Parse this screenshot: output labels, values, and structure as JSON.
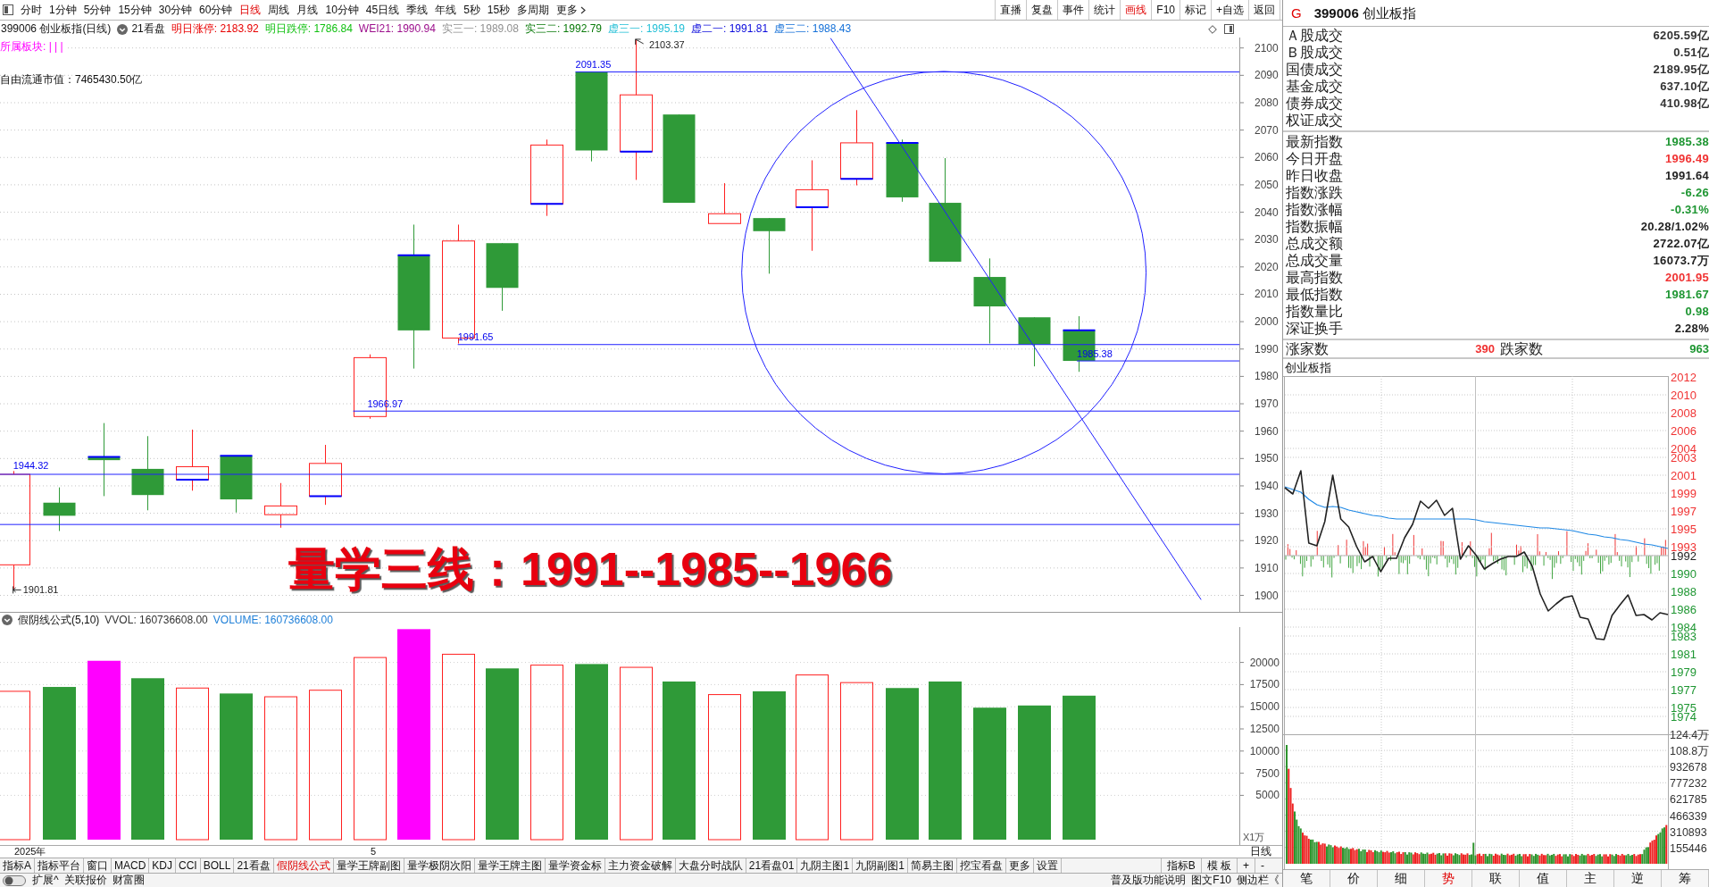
{
  "toolbar": {
    "periods": [
      {
        "label": "分时",
        "selected": false
      },
      {
        "label": "1分钟",
        "selected": false
      },
      {
        "label": "5分钟",
        "selected": false
      },
      {
        "label": "15分钟",
        "selected": false
      },
      {
        "label": "30分钟",
        "selected": false
      },
      {
        "label": "60分钟",
        "selected": false
      },
      {
        "label": "日线",
        "selected": true
      },
      {
        "label": "周线",
        "selected": false
      },
      {
        "label": "月线",
        "selected": false
      },
      {
        "label": "10分钟",
        "selected": false
      },
      {
        "label": "45日线",
        "selected": false
      },
      {
        "label": "季线",
        "selected": false
      },
      {
        "label": "年线",
        "selected": false
      },
      {
        "label": "5秒",
        "selected": false
      },
      {
        "label": "15秒",
        "selected": false
      },
      {
        "label": "多周期",
        "selected": false
      }
    ],
    "more": "更多",
    "tools": [
      {
        "label": "直播",
        "selected": false
      },
      {
        "label": "复盘",
        "selected": false
      },
      {
        "label": "事件",
        "selected": false
      },
      {
        "label": "统计",
        "selected": false
      },
      {
        "label": "画线",
        "selected": true
      },
      {
        "label": "F10",
        "selected": false
      },
      {
        "label": "标记",
        "selected": false
      },
      {
        "label": "+自选",
        "selected": false
      },
      {
        "label": "返回",
        "selected": false
      }
    ]
  },
  "info_line": {
    "title": "399006 创业板指(日线)",
    "template": "21看盘",
    "values": [
      {
        "label": "明日涨停: 2183.92",
        "color": "#e80000"
      },
      {
        "label": "明日跌停: 1786.84",
        "color": "#10c010"
      },
      {
        "label": "WEI21: 1990.94",
        "color": "#9c0f8c"
      },
      {
        "label": "实三一: 1989.08",
        "color": "#909090"
      },
      {
        "label": "实三二: 1992.79",
        "color": "#0a7a0a"
      },
      {
        "label": "虚三一: 1995.19",
        "color": "#22bfd6"
      },
      {
        "label": "虚二一: 1991.81",
        "color": "#0a0adc"
      },
      {
        "label": "虚三二: 1988.43",
        "color": "#1470d8"
      }
    ]
  },
  "main_chart": {
    "sector": "所属板块: | | |",
    "float_cap": "自由流通市值：7465430.50亿",
    "price_ticks": [
      "2100",
      "2090",
      "2080",
      "2070",
      "2060",
      "2050",
      "2040",
      "2030",
      "2020",
      "2010",
      "2000",
      "1990",
      "1980",
      "1970",
      "1960",
      "1950",
      "1940",
      "1930",
      "1920",
      "1910",
      "1900"
    ],
    "labels": [
      {
        "text": "2091.35",
        "kind": "level"
      },
      {
        "text": "2103.37",
        "kind": "high"
      },
      {
        "text": "1991.65",
        "kind": "level"
      },
      {
        "text": "1985.38",
        "kind": "level"
      },
      {
        "text": "1966.97",
        "kind": "level"
      },
      {
        "text": "1944.32",
        "kind": "level"
      },
      {
        "text": "1901.81",
        "kind": "low"
      }
    ],
    "headline": "量学三线：1991--1985--1966"
  },
  "volume_pane": {
    "title": "假阴线公式(5,10)",
    "readings": [
      {
        "label": "VVOL: 160736608.00",
        "color": "#333333"
      },
      {
        "label": "VOLUME: 160736608.00",
        "color": "#1e7fd8"
      }
    ],
    "ticks": [
      "20000",
      "17500",
      "15000",
      "12500",
      "10000",
      "7500",
      "5000"
    ],
    "unit": "X1万"
  },
  "date_axis": {
    "labels": [
      "2025年",
      "5"
    ],
    "period": "日线"
  },
  "indicator_bar": {
    "tabs": [
      {
        "label": "指标A",
        "selected": false
      },
      {
        "label": "指标平台",
        "selected": false
      },
      {
        "label": "窗口",
        "selected": false
      },
      {
        "label": "MACD",
        "selected": false
      },
      {
        "label": "KDJ",
        "selected": false
      },
      {
        "label": "CCI",
        "selected": false
      },
      {
        "label": "BOLL",
        "selected": false
      },
      {
        "label": "21看盘",
        "selected": false
      },
      {
        "label": "假阴线公式",
        "selected": true
      },
      {
        "label": "量学王牌副图",
        "selected": false
      },
      {
        "label": "量学极阴次阳",
        "selected": false
      },
      {
        "label": "量学王牌主图",
        "selected": false
      },
      {
        "label": "量学资金标",
        "selected": false
      },
      {
        "label": "主力资金破解",
        "selected": false
      },
      {
        "label": "大盘分时战队",
        "selected": false
      },
      {
        "label": "21看盘01",
        "selected": false
      },
      {
        "label": "九阴主图1",
        "selected": false
      },
      {
        "label": "九阴副图1",
        "selected": false
      },
      {
        "label": "简易主图",
        "selected": false
      },
      {
        "label": "挖宝看盘",
        "selected": false
      },
      {
        "label": "更多",
        "selected": false
      },
      {
        "label": "设置",
        "selected": false
      }
    ],
    "tools": [
      "指标B",
      "模 板",
      "+",
      "-"
    ]
  },
  "footer": {
    "left": [
      "扩展^",
      "关联报价",
      "财富圈"
    ],
    "right": [
      "普及版功能说明",
      "图文F10",
      "侧边栏《"
    ]
  },
  "quote_panel": {
    "marker": "G",
    "title": "**399006** 创业板指",
    "turnover": [
      {
        "label": "Ａ股成交",
        "value": "6205.59亿"
      },
      {
        "label": "Ｂ股成交",
        "value": "0.51亿"
      },
      {
        "label": "国债成交",
        "value": "2189.95亿"
      },
      {
        "label": "基金成交",
        "value": "637.10亿"
      },
      {
        "label": "债券成交",
        "value": "410.98亿"
      },
      {
        "label": "权证成交"
      }
    ],
    "stats": [
      {
        "label": "最新指数",
        "value": "1985.38",
        "color": "#1e9632"
      },
      {
        "label": "今日开盘",
        "value": "1996.49",
        "color": "#f03232"
      },
      {
        "label": "昨日收盘",
        "value": "1991.64",
        "color": "#222222"
      },
      {
        "label": "指数涨跌",
        "value": "-6.26",
        "color": "#1e9632"
      },
      {
        "label": "指数涨幅",
        "value": "-0.31%",
        "color": "#1e9632"
      },
      {
        "label": "指数振幅",
        "value": "20.28/1.02%",
        "color": "#222222"
      },
      {
        "label": "总成交额",
        "value": "2722.07亿",
        "color": "#222222"
      },
      {
        "label": "总成交量",
        "value": "16073.7万",
        "color": "#222222"
      },
      {
        "label": "最高指数",
        "value": "2001.95",
        "color": "#f03232"
      },
      {
        "label": "最低指数",
        "value": "1981.67",
        "color": "#1e9632"
      },
      {
        "label": "指数量比",
        "value": "0.98",
        "color": "#1e9632"
      },
      {
        "label": "深证换手",
        "value": "2.28%",
        "color": "#222222"
      }
    ],
    "breadth": {
      "up_label": "涨家数",
      "up_count": "390",
      "down_label": "跌家数",
      "down_count": "963"
    }
  },
  "intraday": {
    "title": "创业板指",
    "chart_data": {
      "type": "line",
      "categories": [
        null,
        null,
        null,
        null,
        null,
        null,
        null,
        null,
        null,
        null,
        null,
        null,
        null,
        null,
        null,
        null,
        null,
        null,
        null,
        null,
        null,
        null,
        null,
        null,
        null,
        null,
        null,
        null,
        null,
        null,
        null,
        null,
        null,
        null,
        null,
        null,
        null,
        null,
        null,
        null,
        null,
        null,
        null,
        null,
        null,
        null,
        null,
        null,
        null
      ],
      "ylim": [
        1956.9,
        2012.1
      ],
      "grid": true,
      "ref_lines": [
        {
          "axis": "y",
          "value": 1992
        }
      ],
      "yticks": [
        {
          "value": 2012,
          "label": "2012"
        },
        {
          "value": 2010,
          "label": "2010"
        },
        {
          "value": 2008,
          "label": "2008"
        },
        {
          "value": 2006,
          "label": "2006"
        },
        {
          "value": 2004,
          "label": "2004"
        },
        {
          "value": 2003,
          "label": "2003"
        },
        {
          "value": 2001,
          "label": "2001"
        },
        {
          "value": 1999,
          "label": "1999"
        },
        {
          "value": 1997,
          "label": "1997"
        },
        {
          "value": 1995,
          "label": "1995"
        },
        {
          "value": 1993,
          "label": "1993"
        },
        {
          "value": 1992,
          "label": "1992"
        },
        {
          "value": 1990,
          "label": "1990"
        },
        {
          "value": 1988,
          "label": "1988"
        },
        {
          "value": 1986,
          "label": "1986"
        },
        {
          "value": 1984,
          "label": "1984"
        },
        {
          "value": 1983,
          "label": "1983"
        },
        {
          "value": 1981,
          "label": "1981"
        },
        {
          "value": 1979,
          "label": "1979"
        },
        {
          "value": 1977,
          "label": "1977"
        },
        {
          "value": 1975,
          "label": "1975"
        },
        {
          "value": 1974,
          "label": "1974"
        }
      ],
      "series": [
        {
          "color": "#222222",
          "values": [
            1999.6,
            1998.9,
            2001.5,
            1993.4,
            1993.1,
            1995.8,
            2001.0,
            1996.1,
            1995.2,
            1993.0,
            1991.3,
            1991.9,
            1990.2,
            1991.7,
            1991.7,
            1994.0,
            1995.5,
            1998.1,
            1997.3,
            1998.2,
            1996.5,
            1997.3,
            1991.6,
            1993.1,
            1992.0,
            1990.5,
            1991.1,
            1991.6,
            1991.9,
            1991.9,
            1992.4,
            1990.8,
            1987.7,
            1985.8,
            1986.6,
            1987.3,
            1987.5,
            1985.1,
            1984.9,
            1982.7,
            1982.6,
            1985.3,
            1986.5,
            1987.6,
            1985.3,
            1985.4,
            1984.8,
            1985.6,
            1985.4
          ]
        },
        {
          "color": "#1e88e5",
          "values": [
            1999.7,
            1999.4,
            1999.1,
            1998.3,
            1997.7,
            1997.4,
            1997.5,
            1997.4,
            1997.1,
            1996.9,
            1996.7,
            1996.5,
            1996.4,
            1996.2,
            1996.1,
            1996.1,
            1996.1,
            1996.1,
            1996.1,
            1996.1,
            1996.1,
            1996.1,
            1996.1,
            1996.1,
            1996.0,
            1995.8,
            1995.7,
            1995.6,
            1995.5,
            1995.4,
            1995.3,
            1995.2,
            1995.1,
            1995.1,
            1995.0,
            1994.9,
            1994.8,
            1994.6,
            1994.4,
            1994.3,
            1994.1,
            1994.0,
            1993.8,
            1993.7,
            1993.5,
            1993.3,
            1993.2,
            1993.0,
            1992.8
          ]
        }
      ]
    },
    "volume_ticks": [
      "124.4万",
      "108.8万",
      "932678",
      "777232",
      "621785",
      "466339",
      "310893",
      "155446"
    ],
    "tabs": [
      {
        "label": "笔",
        "selected": false
      },
      {
        "label": "价",
        "selected": false
      },
      {
        "label": "细",
        "selected": false
      },
      {
        "label": "势",
        "selected": true
      },
      {
        "label": "联",
        "selected": false
      },
      {
        "label": "值",
        "selected": false
      },
      {
        "label": "主",
        "selected": false
      },
      {
        "label": "逆",
        "selected": false
      },
      {
        "label": "筹",
        "selected": false
      }
    ]
  }
}
